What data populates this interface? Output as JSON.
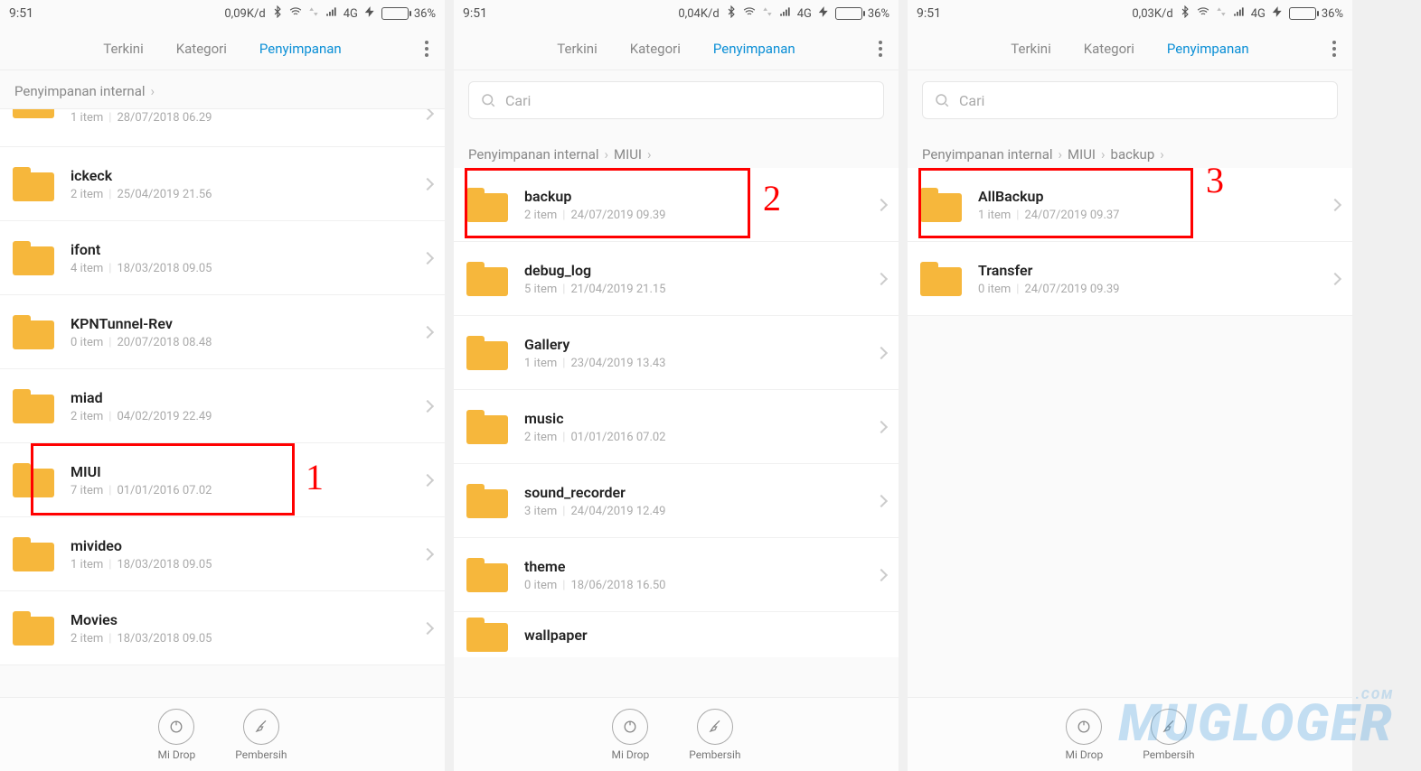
{
  "common": {
    "time": "9:51",
    "network_label": "4G",
    "battery_text": "36%",
    "tabs": {
      "recent": "Terkini",
      "category": "Kategori",
      "storage": "Penyimpanan"
    },
    "search_placeholder": "Cari",
    "midrop": "Mi Drop",
    "cleaner": "Pembersih",
    "breadcrumb_root": "Penyimpanan internal"
  },
  "phone1": {
    "data_rate": "0,09K/d",
    "step": "1",
    "partial_top": {
      "items": "1 item",
      "date": "28/07/2018 06.29"
    },
    "folders": [
      {
        "name": "ickeck",
        "items": "2 item",
        "date": "25/04/2019 21.56"
      },
      {
        "name": "ifont",
        "items": "4 item",
        "date": "18/03/2018 09.05"
      },
      {
        "name": "KPNTunnel-Rev",
        "items": "0 item",
        "date": "20/07/2018 08.48"
      },
      {
        "name": "miad",
        "items": "2 item",
        "date": "04/02/2019 22.49"
      },
      {
        "name": "MIUI",
        "items": "7 item",
        "date": "01/01/2016 07.02",
        "highlight": true
      },
      {
        "name": "mivideo",
        "items": "1 item",
        "date": "18/03/2018 09.05"
      },
      {
        "name": "Movies",
        "items": "2 item",
        "date": "18/03/2018 09.05"
      }
    ]
  },
  "phone2": {
    "data_rate": "0,04K/d",
    "step": "2",
    "breadcrumb": [
      "Penyimpanan internal",
      "MIUI"
    ],
    "folders": [
      {
        "name": "backup",
        "items": "2 item",
        "date": "24/07/2019 09.39",
        "highlight": true
      },
      {
        "name": "debug_log",
        "items": "5 item",
        "date": "21/04/2019 21.15"
      },
      {
        "name": "Gallery",
        "items": "1 item",
        "date": "23/04/2019 13.43"
      },
      {
        "name": "music",
        "items": "2 item",
        "date": "01/01/2016 07.02"
      },
      {
        "name": "sound_recorder",
        "items": "3 item",
        "date": "24/04/2019 12.49"
      },
      {
        "name": "theme",
        "items": "0 item",
        "date": "18/06/2018 16.50"
      }
    ],
    "partial_bottom": {
      "name": "wallpaper"
    }
  },
  "phone3": {
    "data_rate": "0,03K/d",
    "step": "3",
    "breadcrumb": [
      "Penyimpanan internal",
      "MIUI",
      "backup"
    ],
    "folders": [
      {
        "name": "AllBackup",
        "items": "1 item",
        "date": "24/07/2019 09.37",
        "highlight": true
      },
      {
        "name": "Transfer",
        "items": "0 item",
        "date": "24/07/2019 09.39"
      }
    ]
  },
  "watermark": "MUGLOGER",
  "watermark_com": ".COM"
}
